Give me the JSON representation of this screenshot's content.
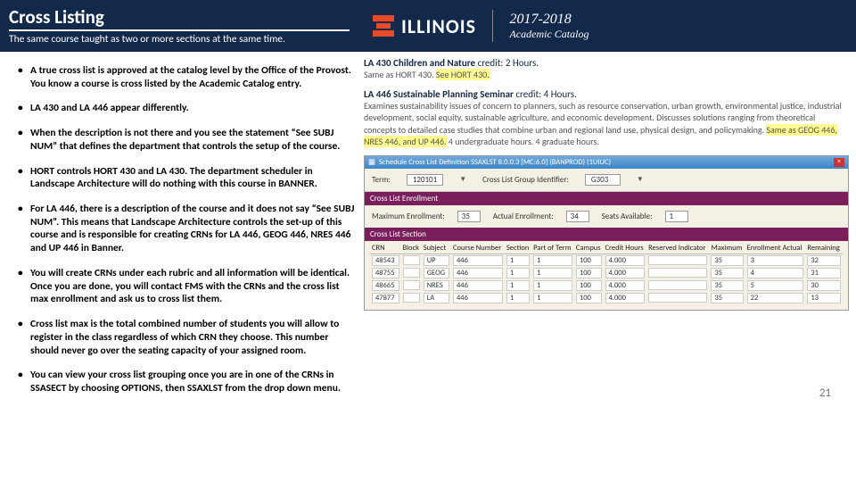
{
  "header": {
    "title": "Cross Listing",
    "subtitle": "The same course taught as two or more sections at the same time.",
    "logo_text": "ILLINOIS",
    "ay1": "2017-2018",
    "ay2": "Academic Catalog"
  },
  "bullets": [
    "A true cross list is approved at the catalog level by the Office of the Provost. You know a course is cross listed by the Academic Catalog entry.",
    "LA 430 and LA 446 appear differently.",
    "When the description is not there and you see the statement “See SUBJ NUM” that defines the department that controls the setup of the course.",
    "HORT controls HORT 430 and LA 430. The department scheduler in Landscape Architecture will do nothing with this course in BANNER.",
    "For LA 446, there is a description of the course and it does not say “See SUBJ NUM”. This means that Landscape Architecture controls the set-up of this course and is responsible for creating CRNs for LA 446, GEOG 446, NRES 446 and UP 446 in Banner.",
    "You will create CRNs under each rubric and all information will be identical. Once you are done, you will contact FMS with the CRNs and the cross list max enrollment and ask us to cross list them.",
    "Cross list max is the total combined number of students you will allow to register in the class regardless of which CRN they choose. This number should never go over the seating capacity of your assigned room.",
    "You can view your cross list grouping once you are in one of the CRNs in SSASECT by choosing OPTIONS, then SSAXLST from the drop down menu."
  ],
  "catalog": {
    "la430": {
      "head": "LA 430   Children and Nature   ",
      "credit": "credit: 2 Hours.",
      "same": "Same as HORT 430. ",
      "see": "See HORT 430."
    },
    "la446": {
      "head": "LA 446   Sustainable Planning Seminar   ",
      "credit": "credit: 4 Hours.",
      "body1": "Examines sustainability issues of concern to planners, such as resource conservation, urban growth, environmental justice, industrial development, social equity, sustainable agriculture, and economic development. Discusses solutions ranging from theoretical concepts to detailed case studies that combine urban and regional land use, physical design, and policymaking. ",
      "hl": "Same as GEOG 446, NRES 446, and UP 446.",
      "body2": " 4 undergraduate hours. 4 graduate hours."
    }
  },
  "banner": {
    "title": "Schedule Cross List Definition SSAXLST 8.0.0.3 [MC:6.0] (BANPROD) (1UIUC)",
    "term_label": "Term:",
    "term_value": "120101",
    "group_label": "Cross List Group Identifier:",
    "group_value": "G303",
    "sec_enroll": "Cross List Enrollment",
    "max_label": "Maximum Enrollment:",
    "max_value": "35",
    "actual_label": "Actual Enrollment:",
    "actual_value": "34",
    "seats_label": "Seats Available:",
    "seats_value": "1",
    "sec_section": "Cross List Section",
    "cols": [
      "CRN",
      "Block",
      "Subject",
      "Course Number",
      "Section",
      "Part of Term",
      "Campus",
      "Credit Hours",
      "Reserved Indicator",
      "Maximum",
      "Enrollment Actual",
      "Remaining"
    ],
    "rows": [
      {
        "crn": "48543",
        "block": "",
        "subject": "UP",
        "course": "446",
        "section": "1",
        "part": "1",
        "campus": "100",
        "credit": "4.000",
        "reserved": "",
        "max": "35",
        "actual": "3",
        "remain": "32"
      },
      {
        "crn": "48755",
        "block": "",
        "subject": "GEOG",
        "course": "446",
        "section": "1",
        "part": "1",
        "campus": "100",
        "credit": "4.000",
        "reserved": "",
        "max": "35",
        "actual": "4",
        "remain": "31"
      },
      {
        "crn": "48665",
        "block": "",
        "subject": "NRES",
        "course": "446",
        "section": "1",
        "part": "1",
        "campus": "100",
        "credit": "4.000",
        "reserved": "",
        "max": "35",
        "actual": "5",
        "remain": "30"
      },
      {
        "crn": "47877",
        "block": "",
        "subject": "LA",
        "course": "446",
        "section": "1",
        "part": "1",
        "campus": "100",
        "credit": "4.000",
        "reserved": "",
        "max": "35",
        "actual": "22",
        "remain": "13"
      }
    ]
  },
  "page_number": "21"
}
